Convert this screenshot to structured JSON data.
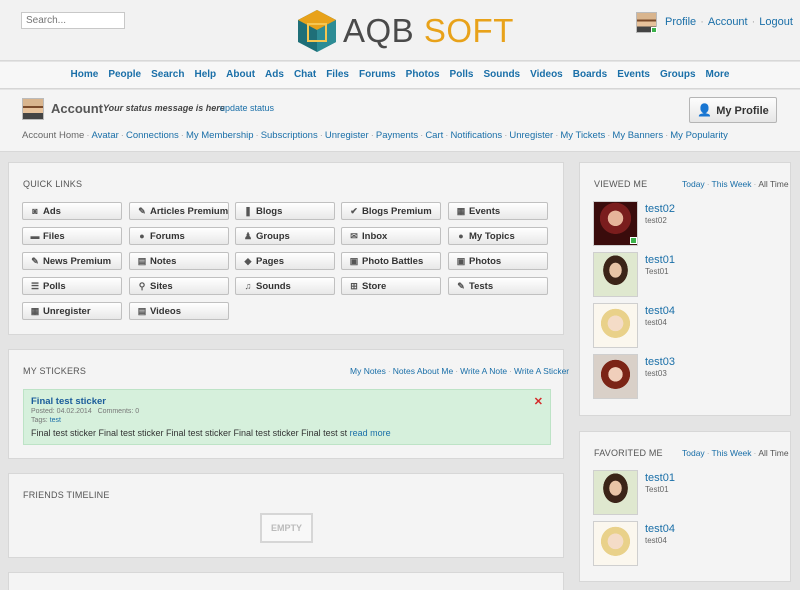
{
  "header": {
    "search_placeholder": "Search...",
    "logo_aqb": "AQB",
    "logo_soft": "SOFT",
    "links": [
      "Profile",
      "Account",
      "Logout"
    ]
  },
  "nav": [
    "Home",
    "People",
    "Search",
    "Help",
    "About",
    "Ads",
    "Chat",
    "Files",
    "Forums",
    "Photos",
    "Polls",
    "Sounds",
    "Videos",
    "Boards",
    "Events",
    "Groups",
    "More"
  ],
  "account": {
    "title": "Account",
    "status": "Your status message is here",
    "update_link": "update status",
    "my_profile_label": "My Profile",
    "subnav": [
      "Account Home",
      "Avatar",
      "Connections",
      "My Membership",
      "Subscriptions",
      "Unregister",
      "Payments",
      "Cart",
      "Notifications",
      "Unregister",
      "My Tickets",
      "My Banners",
      "My Popularity"
    ]
  },
  "quick_links": {
    "title": "QUICK LINKS",
    "items": [
      {
        "label": "Ads",
        "icon": "ads-icon",
        "glyph": "◙"
      },
      {
        "label": "Articles Premium",
        "icon": "articles-premium-icon",
        "glyph": "✎"
      },
      {
        "label": "Blogs",
        "icon": "blogs-icon",
        "glyph": "❚"
      },
      {
        "label": "Blogs Premium",
        "icon": "blogs-premium-icon",
        "glyph": "✔"
      },
      {
        "label": "Events",
        "icon": "calendar-icon",
        "glyph": "▦"
      },
      {
        "label": "Files",
        "icon": "files-icon",
        "glyph": "▬"
      },
      {
        "label": "Forums",
        "icon": "forums-icon",
        "glyph": "●"
      },
      {
        "label": "Groups",
        "icon": "groups-icon",
        "glyph": "♟"
      },
      {
        "label": "Inbox",
        "icon": "inbox-icon",
        "glyph": "✉"
      },
      {
        "label": "My Topics",
        "icon": "topics-icon",
        "glyph": "●"
      },
      {
        "label": "News Premium",
        "icon": "news-premium-icon",
        "glyph": "✎"
      },
      {
        "label": "Notes",
        "icon": "notes-icon",
        "glyph": "▤"
      },
      {
        "label": "Pages",
        "icon": "pages-icon",
        "glyph": "◆"
      },
      {
        "label": "Photo Battles",
        "icon": "photo-battles-icon",
        "glyph": "▣"
      },
      {
        "label": "Photos",
        "icon": "photos-icon",
        "glyph": "▣"
      },
      {
        "label": "Polls",
        "icon": "polls-icon",
        "glyph": "☰"
      },
      {
        "label": "Sites",
        "icon": "sites-icon",
        "glyph": "⚲"
      },
      {
        "label": "Sounds",
        "icon": "sounds-icon",
        "glyph": "♫"
      },
      {
        "label": "Store",
        "icon": "cart-icon",
        "glyph": "⊞"
      },
      {
        "label": "Tests",
        "icon": "tests-icon",
        "glyph": "✎"
      },
      {
        "label": "Unregister",
        "icon": "unregister-icon",
        "glyph": "▦"
      },
      {
        "label": "Videos",
        "icon": "videos-icon",
        "glyph": "▤"
      }
    ]
  },
  "stickers": {
    "title": "MY STICKERS",
    "links": [
      "My Notes",
      "Notes About Me",
      "Write A Note",
      "Write A Sticker"
    ],
    "item": {
      "title": "Final test sticker",
      "posted": "Posted: 04.02.2014",
      "comments": "Comments: 0",
      "tags_label": "Tags:",
      "tag": "test",
      "text": "Final test sticker Final test sticker Final test sticker Final test sticker Final test st",
      "more": "read more",
      "close": "✕"
    }
  },
  "friends_timeline": {
    "title": "FRIENDS TIMELINE",
    "empty": "EMPTY"
  },
  "viewed_me": {
    "title": "VIEWED ME",
    "filters": [
      "Today",
      "This Week",
      "All Time"
    ],
    "people": [
      {
        "name": "test02",
        "sub": "test02",
        "online": true,
        "photo": "ph-dark"
      },
      {
        "name": "test01",
        "sub": "Test01",
        "online": false,
        "photo": "ph-green"
      },
      {
        "name": "test04",
        "sub": "test04",
        "online": false,
        "photo": "ph-blonde"
      },
      {
        "name": "test03",
        "sub": "test03",
        "online": false,
        "photo": "ph-red"
      }
    ]
  },
  "favorited_me": {
    "title": "FAVORITED ME",
    "filters": [
      "Today",
      "This Week",
      "All Time"
    ],
    "people": [
      {
        "name": "test01",
        "sub": "Test01",
        "online": false,
        "photo": "ph-green"
      },
      {
        "name": "test04",
        "sub": "test04",
        "online": false,
        "photo": "ph-blonde"
      }
    ]
  },
  "colors": {
    "link": "#1a6fa8",
    "logo_gray": "#4a4a4a",
    "logo_orange": "#e8a21a",
    "sticker_bg": "#d6f0dc",
    "close_red": "#d42a2a",
    "online_green": "#3bb14a"
  }
}
